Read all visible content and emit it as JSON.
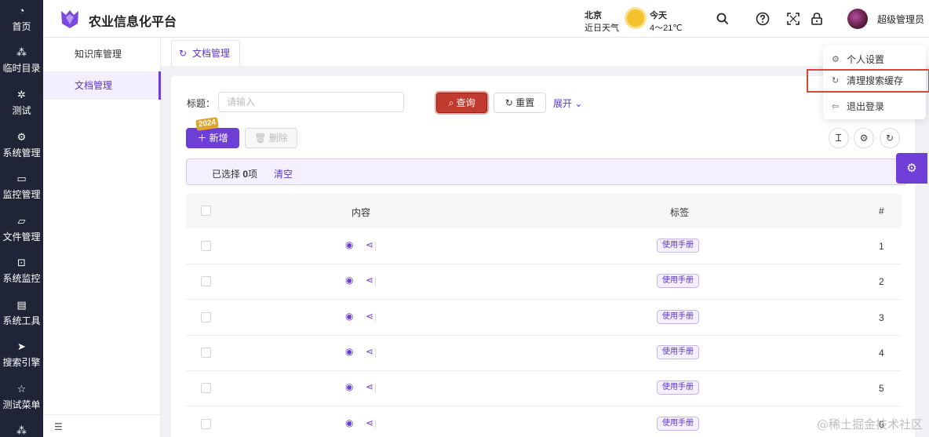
{
  "app": {
    "title": "农业信息化平台",
    "brand_color": "#6d3fd6",
    "nav_bg": "#1f2436"
  },
  "nav": {
    "items": [
      {
        "label": "首页",
        "icon": "dashboard-icon"
      },
      {
        "label": "临时目录",
        "icon": "tree-icon"
      },
      {
        "label": "测试",
        "icon": "bug-icon"
      },
      {
        "label": "系统管理",
        "icon": "gear-icon"
      },
      {
        "label": "监控管理",
        "icon": "video-icon"
      },
      {
        "label": "文件管理",
        "icon": "folder-icon"
      },
      {
        "label": "系统监控",
        "icon": "monitor-icon"
      },
      {
        "label": "系统工具",
        "icon": "toolbox-icon"
      },
      {
        "label": "搜索引擎",
        "icon": "paper-plane-icon"
      },
      {
        "label": "测试菜单",
        "icon": "star-icon"
      }
    ]
  },
  "header": {
    "weather": {
      "city": "北京",
      "label": "近日天气",
      "day": "今天",
      "temp": "4～21℃",
      "icon": "sun-icon"
    },
    "user": {
      "name": "超级管理员"
    }
  },
  "subnav": {
    "items": [
      {
        "label": "知识库管理",
        "active": false
      },
      {
        "label": "文档管理",
        "active": true
      }
    ]
  },
  "tabs": [
    {
      "label": "文档管理"
    }
  ],
  "search": {
    "title_label": "标题：",
    "title_placeholder": "请输入",
    "query_label": "查询",
    "reset_label": "重置",
    "expand_label": "展开"
  },
  "toolbar": {
    "add_label": "新增",
    "delete_label": "删除",
    "badge": "2024"
  },
  "selection": {
    "prefix": "已选择",
    "count": "0",
    "suffix": "项",
    "clear_label": "清空"
  },
  "table": {
    "columns": [
      "内容",
      "标签",
      "#"
    ],
    "rows": [
      {
        "tag": "使用手册",
        "num": "1"
      },
      {
        "tag": "使用手册",
        "num": "2"
      },
      {
        "tag": "使用手册",
        "num": "3"
      },
      {
        "tag": "使用手册",
        "num": "4"
      },
      {
        "tag": "使用手册",
        "num": "5"
      },
      {
        "tag": "使用手册",
        "num": "6"
      }
    ]
  },
  "user_menu": {
    "items": [
      {
        "label": "个人设置",
        "icon": "gear-icon",
        "highlighted": false
      },
      {
        "label": "清理搜索缓存",
        "icon": "refresh-icon",
        "highlighted": true
      },
      {
        "label": "退出登录",
        "icon": "logout-icon",
        "highlighted": false
      }
    ],
    "highlight_color": "#d9463a"
  },
  "watermark": "@稀土掘金技术社区"
}
